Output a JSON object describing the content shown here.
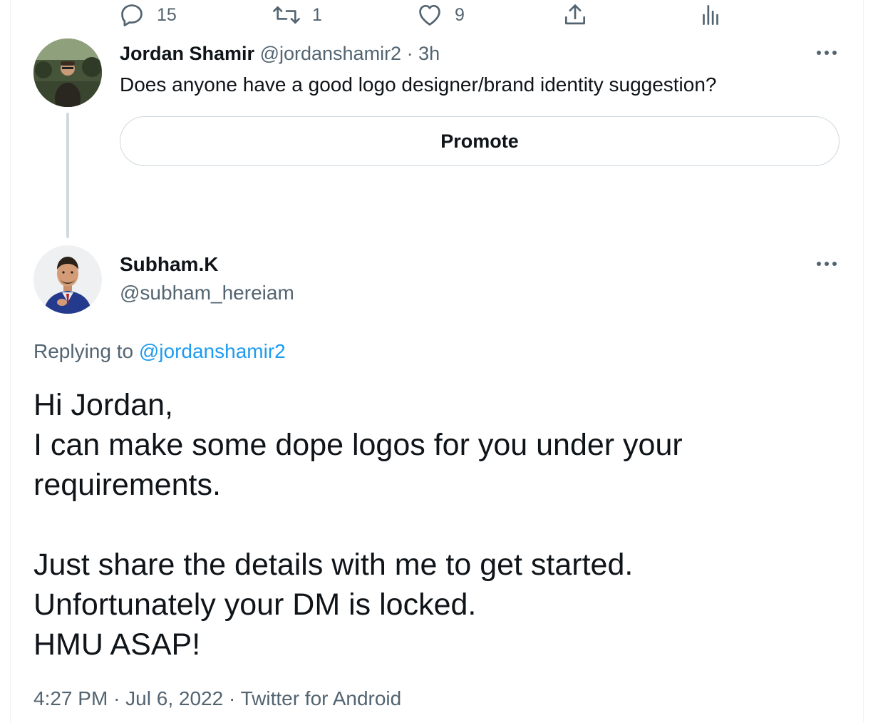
{
  "colors": {
    "text_primary": "#0f1419",
    "text_secondary": "#536471",
    "link": "#1d9bf0",
    "border": "#cfd9de"
  },
  "parent_tweet": {
    "display_name": "Jordan Shamir",
    "handle": "@jordanshamir2",
    "separator": "·",
    "time": "3h",
    "text": "Does anyone have a good logo designer/brand identity suggestion?",
    "promote_label": "Promote",
    "more_icon": "more-horizontal-icon",
    "actions": {
      "reply": {
        "icon": "reply-icon",
        "count": "15"
      },
      "retweet": {
        "icon": "retweet-icon",
        "count": "1"
      },
      "like": {
        "icon": "heart-icon",
        "count": "9"
      },
      "share": {
        "icon": "share-icon"
      },
      "analytics": {
        "icon": "analytics-icon"
      }
    }
  },
  "reply_tweet": {
    "display_name": "Subham.K",
    "handle": "@subham_hereiam",
    "replying_to_prefix": "Replying to",
    "replying_to_handle": "@jordanshamir2",
    "more_icon": "more-horizontal-icon",
    "body_lines": [
      "Hi Jordan,",
      "I can make some dope logos for you under your",
      "requirements.",
      "",
      "Just share the details with me to get started.",
      "Unfortunately your DM is locked.",
      "HMU ASAP!"
    ],
    "time": "4:27 PM",
    "date": "Jul 6, 2022",
    "source": "Twitter for Android",
    "separator": "·"
  }
}
